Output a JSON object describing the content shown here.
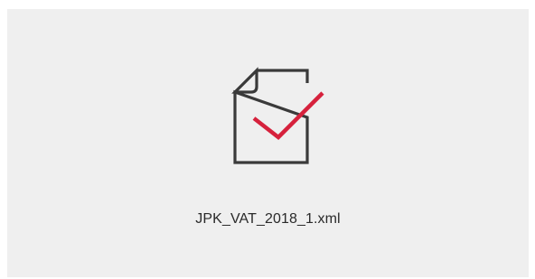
{
  "file": {
    "name": "JPK_VAT_2018_1.xml",
    "icon": "file-check-icon"
  },
  "colors": {
    "background": "#efefef",
    "document_stroke": "#3a3a3a",
    "check_accent": "#d6213c",
    "text": "#2a2a2a"
  }
}
